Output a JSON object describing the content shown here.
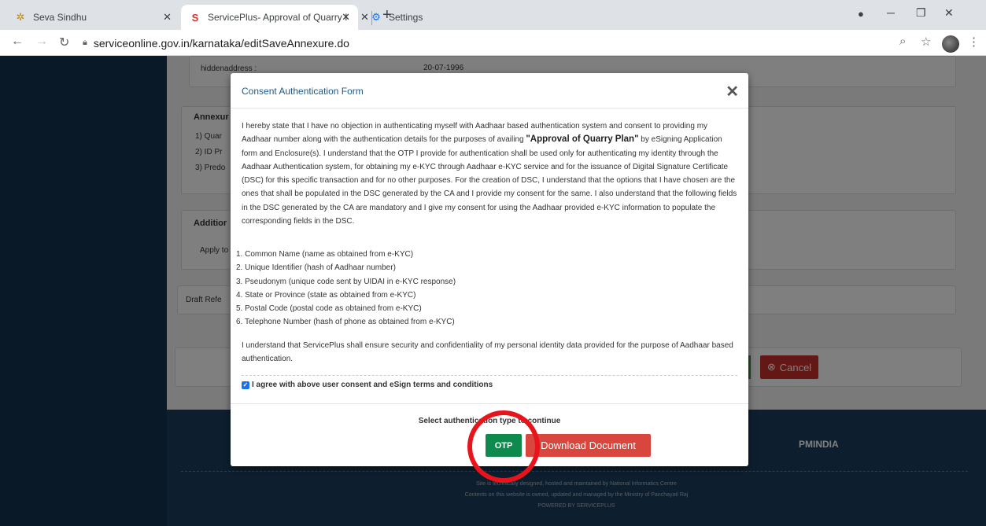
{
  "browser": {
    "tabs": [
      {
        "label": "Seva Sindhu"
      },
      {
        "label": "ServicePlus- Approval of Quarry I"
      },
      {
        "label": "Settings"
      }
    ],
    "url": "serviceonline.gov.in/karnataka/editSaveAnnexure.do"
  },
  "background": {
    "hiddenaddress_label": "hiddenaddress :",
    "hiddenaddress_value": "20-07-1996",
    "annexure_heading": "Annexur",
    "annexure_items": [
      "1)    Quar",
      "2)    ID Pr",
      "3)    Predo"
    ],
    "additional_heading": "Additior",
    "apply_to": "Apply to",
    "draft_ref": "Draft Refe",
    "cancel_label": "Cancel",
    "pmindia": "PMINDIA",
    "footer_lines": [
      "Site is technically designed, hosted and maintained by National Informatics Centre",
      "Contents on this website is owned, updated and managed by the Ministry of Panchayati Raj",
      "POWERED BY SERVICEPLUS"
    ]
  },
  "modal": {
    "title": "Consent Authentication Form",
    "para1_start": "I hereby state that I have no objection in authenticating myself with Aadhaar based authentication system and consent to providing my Aadhaar number along with the authentication details for the purposes of availing ",
    "para1_bold": "\"Approval of Quarry Plan\"",
    "para1_end": " by eSigning Application form and Enclosure(s). I understand that the OTP I provide for authentication shall be used only for authenticating my identity through the Aadhaar Authentication system, for obtaining my e-KYC through Aadhaar e-KYC service and for the issuance of Digital Signature Certificate (DSC) for this specific transaction and for no other purposes. For the creation of DSC, I understand that the options that I have chosen are the ones that shall be populated in the DSC generated by the CA and I provide my consent for the same. I also understand that the following fields in the DSC generated by the CA are mandatory and I give my consent for using the Aadhaar provided e-KYC information to populate the corresponding fields in the DSC.",
    "list": [
      "1. Common Name (name as obtained from e-KYC)",
      "2. Unique Identifier (hash of Aadhaar number)",
      "3. Pseudonym (unique code sent by UIDAI in e-KYC response)",
      "4. State or Province (state as obtained from e-KYC)",
      "5. Postal Code (postal code as obtained from e-KYC)",
      "6. Telephone Number (hash of phone as obtained from e-KYC)"
    ],
    "para2": "I understand that ServicePlus shall ensure security and confidentiality of my personal identity data provided for the purpose of Aadhaar based authentication.",
    "agree_label": "I agree with above user consent and eSign terms and conditions",
    "agree_checked": true,
    "select_auth": "Select authentication type to continue",
    "otp_label": "OTP",
    "download_label": "Download Document"
  }
}
